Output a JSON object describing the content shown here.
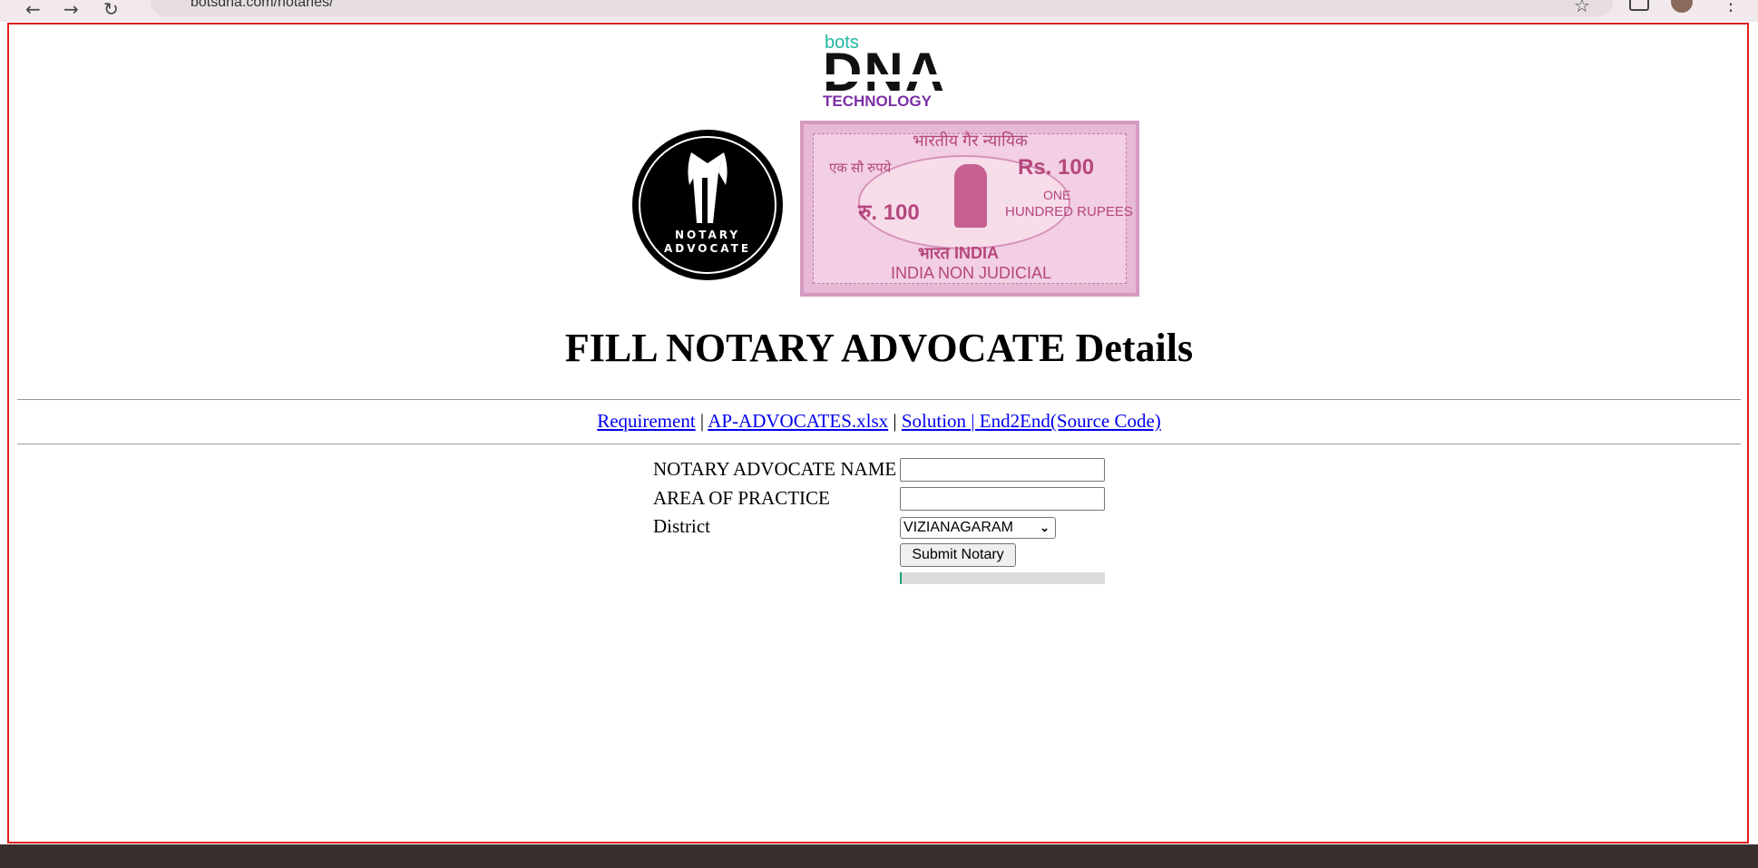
{
  "browser": {
    "url": "botsdna.com/notaries/"
  },
  "logo": {
    "top_text": "bots",
    "main_text": "DNA",
    "bottom_text": "TECHNOLOGY"
  },
  "badge": {
    "line1": "NOTARY",
    "line2": "ADVOCATE"
  },
  "stamp": {
    "hindi_top": "भारतीय गैर न्यायिक",
    "hindi_left": "एक सौ रुपये",
    "rs_right": "Rs. 100",
    "ru_left": "रु. 100",
    "one": "ONE",
    "hundred_rupees": "HUNDRED RUPEES",
    "bharat_india": "भारत INDIA",
    "non_judicial": "INDIA NON JUDICIAL"
  },
  "page": {
    "title": "FILL NOTARY ADVOCATE Details"
  },
  "links": {
    "requirement": "Requirement",
    "sep1": " | ",
    "ap_advocates": "AP-ADVOCATES.xlsx",
    "sep2": " | ",
    "solution": "Solution ",
    "sep3": "| ",
    "end2end": "End2End(Source Code)"
  },
  "form": {
    "name_label": "NOTARY ADVOCATE NAME",
    "name_value": "",
    "area_label": "AREA OF PRACTICE",
    "area_value": "",
    "district_label": "District",
    "district_selected": "VIZIANAGARAM",
    "submit_label": "Submit Notary",
    "progress_fraction": 0.01
  },
  "colors": {
    "frame_border": "#e02020",
    "link": "#0000ee",
    "progress_fill": "#1aa37a"
  }
}
